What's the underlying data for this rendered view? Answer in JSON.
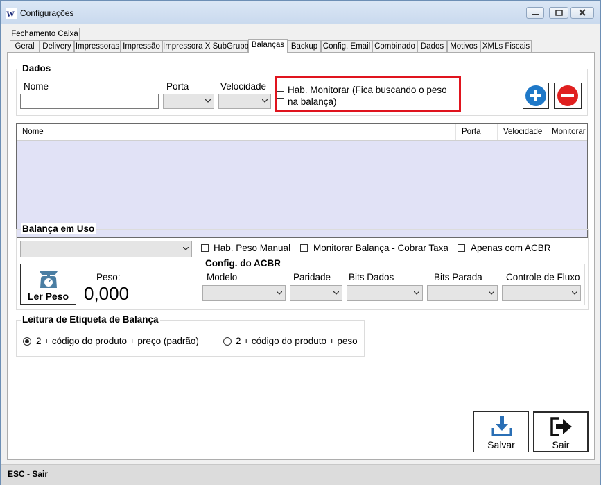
{
  "window": {
    "title": "Configurações"
  },
  "tabs_row1": [
    {
      "label": "Fechamento Caixa"
    }
  ],
  "tabs_row2": [
    {
      "label": "Geral"
    },
    {
      "label": "Delivery"
    },
    {
      "label": "Impressoras"
    },
    {
      "label": "Impressão"
    },
    {
      "label": "Impressora X SubGrupo"
    },
    {
      "label": "Balanças"
    },
    {
      "label": "Backup"
    },
    {
      "label": "Config. Email"
    },
    {
      "label": "Combinado"
    },
    {
      "label": "Dados"
    },
    {
      "label": "Motivos"
    },
    {
      "label": "XMLs Fiscais"
    }
  ],
  "active_tab": "Balanças",
  "dados": {
    "title": "Dados",
    "nome_label": "Nome",
    "nome_value": "",
    "porta_label": "Porta",
    "velocidade_label": "Velocidade",
    "monitor_label_line1": "Hab. Monitorar (Fica buscando o peso",
    "monitor_label_line2": "na balança)",
    "monitor_checked": false
  },
  "grid": {
    "columns": [
      "Nome",
      "Porta",
      "Velocidade",
      "Monitorar"
    ],
    "rows": []
  },
  "balanca_uso": {
    "title": "Balança em Uso",
    "selected": "",
    "hab_peso_manual": "Hab. Peso Manual",
    "monitorar_taxa": "Monitorar Balança - Cobrar Taxa",
    "apenas_acbr": "Apenas com ACBR",
    "ler_peso_label": "Ler Peso",
    "peso_label": "Peso:",
    "peso_value": "0,000",
    "acbr": {
      "title": "Config. do ACBR",
      "modelo": "Modelo",
      "paridade": "Paridade",
      "bits_dados": "Bits Dados",
      "bits_parada": "Bits Parada",
      "controle_fluxo": "Controle de Fluxo"
    }
  },
  "etiqueta": {
    "title": "Leitura de Etiqueta de Balança",
    "option1": "2 + código do produto + preço (padrão)",
    "option2": "2 + código do produto + peso",
    "selected": 1
  },
  "buttons": {
    "salvar": "Salvar",
    "sair": "Sair"
  },
  "statusbar": {
    "text": "ESC - Sair"
  },
  "colors": {
    "highlight_border": "#e0141e",
    "add": "#1e78c8",
    "remove": "#e02020",
    "grid_body": "#e1e2f6"
  }
}
